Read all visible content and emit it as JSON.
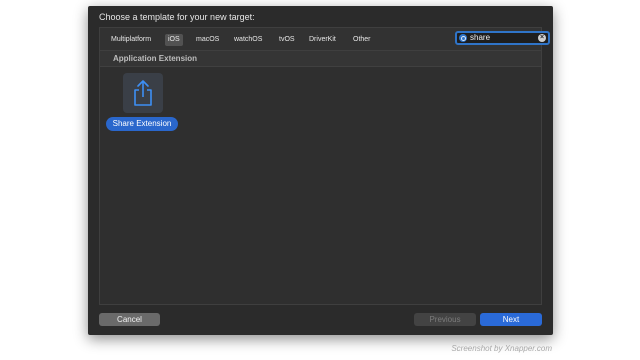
{
  "dialog": {
    "title": "Choose a template for your new target:"
  },
  "tabs": [
    {
      "label": "Multiplatform",
      "active": false
    },
    {
      "label": "iOS",
      "active": true
    },
    {
      "label": "macOS",
      "active": false
    },
    {
      "label": "watchOS",
      "active": false
    },
    {
      "label": "tvOS",
      "active": false
    },
    {
      "label": "DriverKit",
      "active": false
    },
    {
      "label": "Other",
      "active": false
    }
  ],
  "search": {
    "value": "share",
    "icon": "search-icon",
    "clear_icon": "clear-icon"
  },
  "section": {
    "title": "Application Extension"
  },
  "templates": [
    {
      "label": "Share Extension",
      "icon": "share-icon",
      "selected": true
    }
  ],
  "buttons": {
    "cancel": "Cancel",
    "previous": "Previous",
    "next": "Next"
  },
  "watermark": "Screenshot by Xnapper.com",
  "colors": {
    "accent": "#2a6ad8",
    "dialog_bg": "#2b2b2b"
  }
}
